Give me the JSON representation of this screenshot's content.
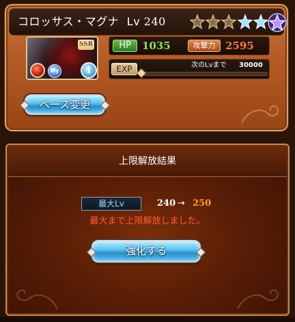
{
  "character": {
    "name": "コロッサス・マグナ",
    "level_label": "Lv",
    "level": "240",
    "rarity": "SSR",
    "stars": [
      {
        "type": "bronze",
        "icon": "bronze-star-icon"
      },
      {
        "type": "bronze",
        "icon": "bronze-star-icon"
      },
      {
        "type": "bronze",
        "icon": "bronze-star-icon"
      },
      {
        "type": "blue",
        "icon": "blue-star-icon"
      },
      {
        "type": "blue",
        "icon": "blue-star-icon"
      },
      {
        "type": "purple",
        "icon": "purple-star-icon"
      }
    ],
    "element_icon": "fire-orb-icon",
    "my_badge": "My",
    "info_icon_glyph": "i"
  },
  "stats": {
    "hp_label": "HP",
    "hp": "1035",
    "atk_label": "攻撃力",
    "atk": "2595",
    "exp_label": "EXP",
    "next_label": "次のLvまで",
    "next_value": "30000",
    "exp_progress": 0
  },
  "buttons": {
    "change_base": "ベース変更",
    "enhance": "強化する"
  },
  "result": {
    "title": "上限解放結果",
    "max_level_label": "最大Lv",
    "old_level": "240",
    "arrow": "→",
    "new_level": "250",
    "message": "最大まで上限解放しました。"
  },
  "colors": {
    "hp_value": "#8fe05c",
    "atk_value": "#ff7a3a",
    "new_level": "#ffa530",
    "message": "#ff5a3a",
    "panel_border": "#c98a52"
  }
}
